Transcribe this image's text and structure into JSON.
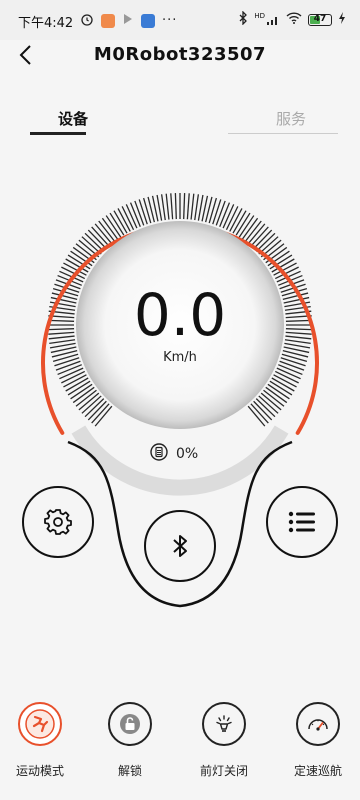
{
  "status_bar": {
    "time": "下午4:42",
    "more": "···",
    "hd": "HD",
    "battery": "47",
    "battery_level": 0.47
  },
  "header": {
    "title": "M0Robot323507"
  },
  "tabs": [
    {
      "label": "设备",
      "active": true
    },
    {
      "label": "服务",
      "active": false
    }
  ],
  "dashboard": {
    "speed": "0.0",
    "unit": "Km/h",
    "battery_percent": "0%"
  },
  "bottom_nav": [
    {
      "label": "运动模式",
      "icon": "sport-mode-icon"
    },
    {
      "label": "解锁",
      "icon": "unlock-icon"
    },
    {
      "label": "前灯关闭",
      "icon": "headlight-icon"
    },
    {
      "label": "定速巡航",
      "icon": "cruise-control-icon"
    }
  ],
  "colors": {
    "accent": "#e8502b",
    "bg": "#f5f5f5",
    "dark": "#111111"
  }
}
